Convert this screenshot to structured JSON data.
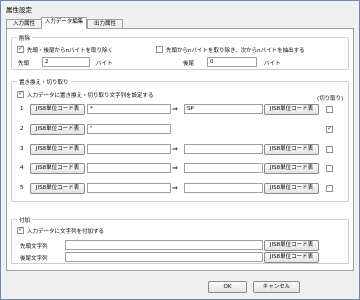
{
  "window": {
    "title": "属性設定"
  },
  "tabs": [
    {
      "label": "入力属性"
    },
    {
      "label": "入力データ編集"
    },
    {
      "label": "出力属性"
    }
  ],
  "delete_group": {
    "title": "削除",
    "option1_label": "先頭・後尾からnバイトを取り除く",
    "option1_checked": true,
    "option2_label": "先頭からnバイトを取り除き、次からnバイトを抽出する",
    "option2_checked": false,
    "head_label": "先頭",
    "head_value": "2",
    "head_unit": "バイト",
    "tail_label": "後尾",
    "tail_value": "0",
    "tail_unit": "バイト"
  },
  "replace_group": {
    "title": "置き換え・切り取り",
    "enable_label": "入力データに置き換え・切り取り文字列を設定する",
    "enable_checked": true,
    "cut_header": "(切り取り)",
    "code_button": "JIS8単位コード表",
    "rows": [
      {
        "num": "1",
        "source": "*",
        "target": "SP",
        "cut": false
      },
      {
        "num": "2",
        "source": "\"",
        "target": "",
        "cut": true
      },
      {
        "num": "3",
        "source": "",
        "target": "",
        "cut": false
      },
      {
        "num": "4",
        "source": "",
        "target": "",
        "cut": false
      },
      {
        "num": "5",
        "source": "",
        "target": "",
        "cut": false
      }
    ]
  },
  "append_group": {
    "title": "付加",
    "enable_label": "入力データに文字列を付加する",
    "enable_checked": true,
    "prefix_label": "先頭文字列",
    "prefix_value": "",
    "suffix_label": "後尾文字列",
    "suffix_value": "",
    "code_button": "JIS8単位コード表"
  },
  "footer": {
    "ok_label": "OK",
    "cancel_label": "キャンセル"
  },
  "icons": {
    "arrow": "⇒"
  }
}
